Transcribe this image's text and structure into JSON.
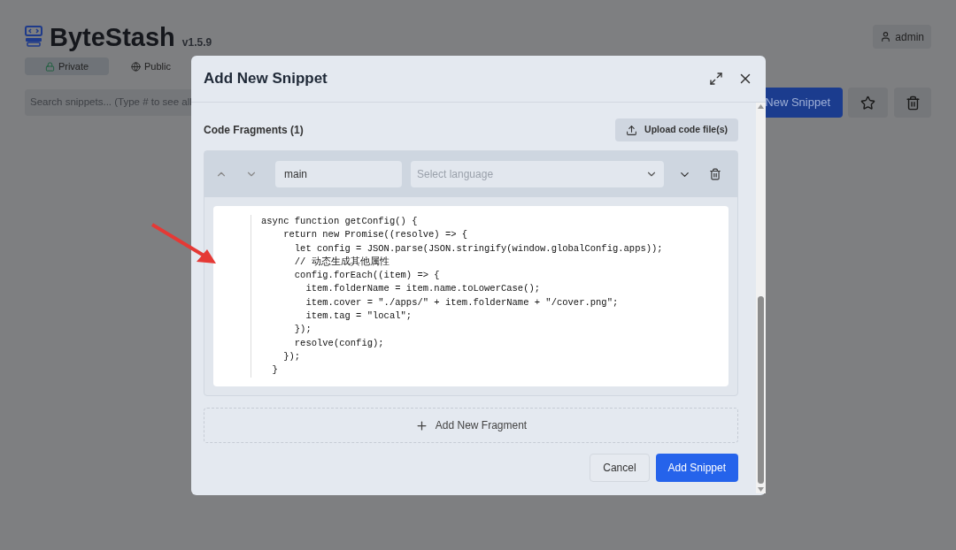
{
  "app": {
    "logo_text": "ByteStash",
    "version": "v1.5.9",
    "visibility_tabs": [
      {
        "label": "Private",
        "selected": true
      },
      {
        "label": "Public",
        "selected": false
      }
    ],
    "search": {
      "placeholder": "Search snippets... (Type # to see all"
    },
    "new_button": "New Snippet",
    "user": "admin"
  },
  "dialog": {
    "title": "Add New Snippet",
    "section_title": "Code Fragments (1)",
    "upload_button": "Upload code file(s)",
    "fragments": [
      {
        "name": "main",
        "language_placeholder": "Select language",
        "code": [
          "async function getConfig() {",
          "    return new Promise((resolve) => {",
          "      let config = JSON.parse(JSON.stringify(window.globalConfig.apps));",
          "      // 动态生成其他属性",
          "      config.forEach((item) => {",
          "        item.folderName = item.name.toLowerCase();",
          "        item.cover = \"./apps/\" + item.folderName + \"/cover.png\";",
          "        item.tag = \"local\";",
          "      });",
          "      resolve(config);",
          "    });",
          "  }"
        ]
      }
    ],
    "add_fragment": "Add New Fragment",
    "cancel_button": "Cancel",
    "submit_button": "Add Snippet"
  }
}
